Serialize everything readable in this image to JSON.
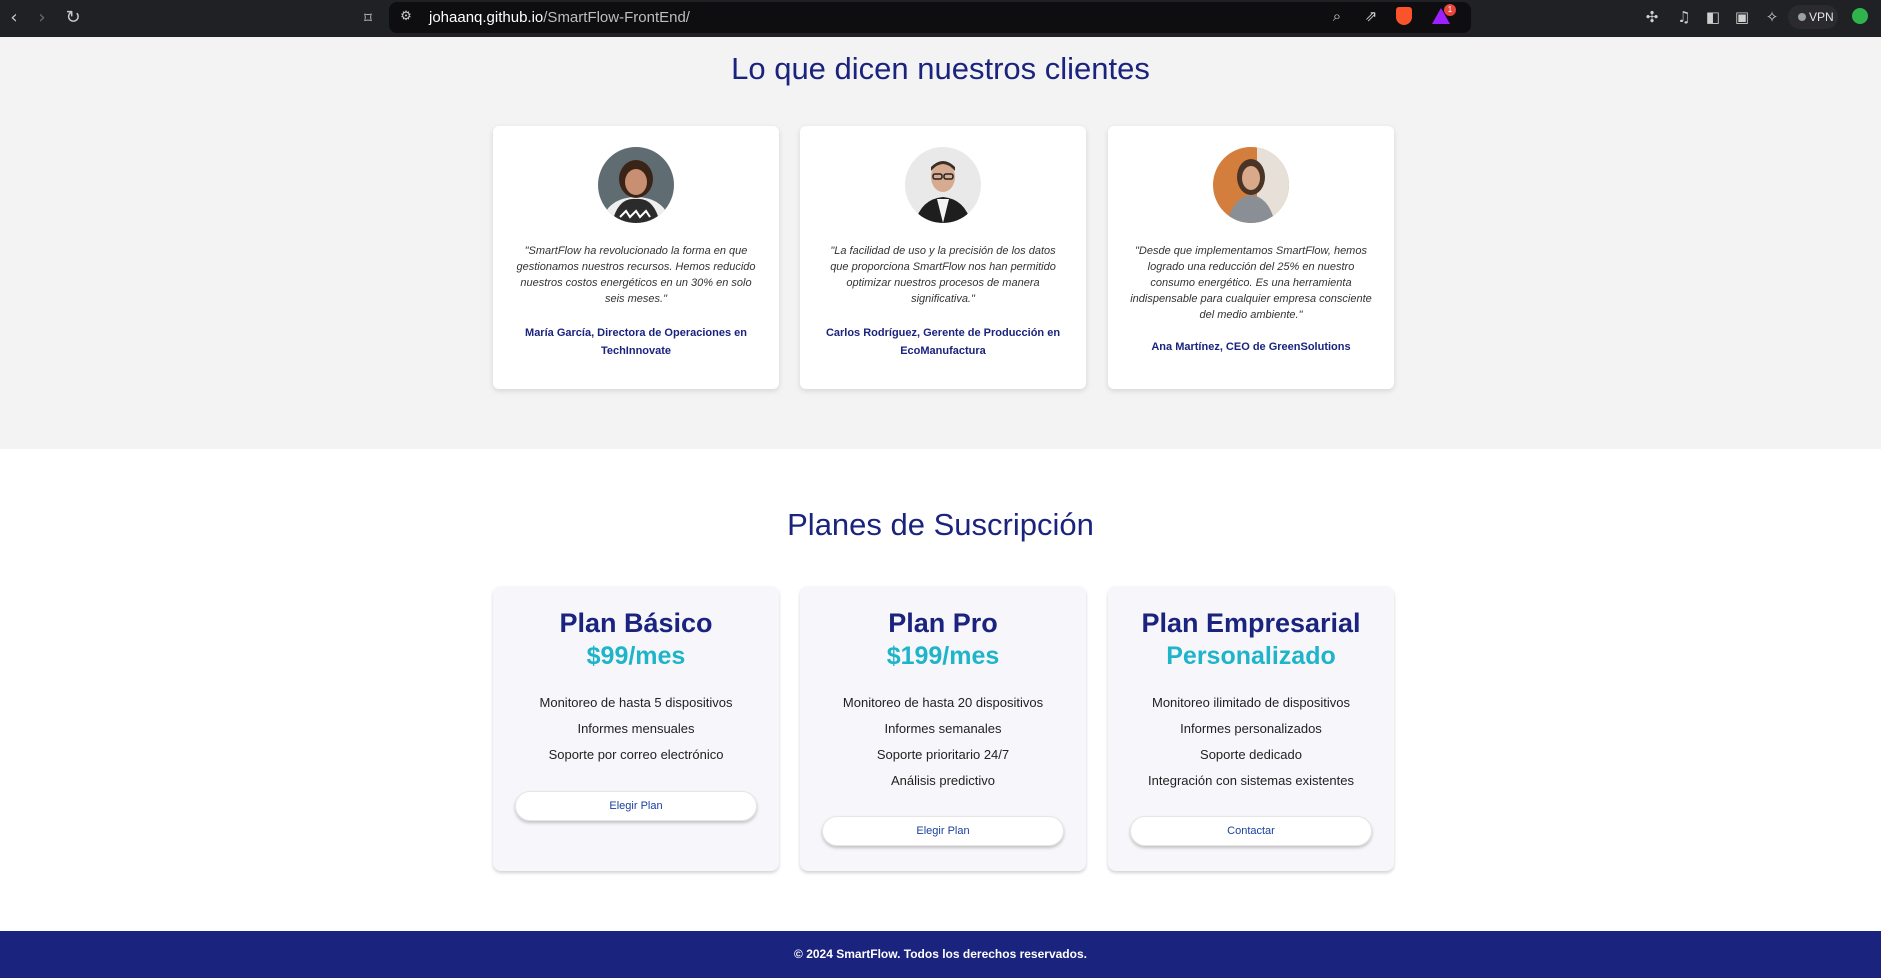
{
  "browser": {
    "url_domain": "johaanq.github.io",
    "url_path": "/SmartFlow-FrontEnd/",
    "notification_count": "1",
    "vpn_label": "VPN",
    "icons": [
      "back-icon",
      "forward-icon",
      "reload-icon",
      "bookmark-icon",
      "site-settings-icon",
      "zoom-icon",
      "share-icon",
      "brave-shields-icon",
      "brave-rewards-icon",
      "extensions-icon",
      "media-icon",
      "sidebar-icon",
      "wallet-icon",
      "leo-ai-icon",
      "profile-icon"
    ]
  },
  "testimonials": {
    "title": "Lo que dicen nuestros clientes",
    "items": [
      {
        "quote": "\"SmartFlow ha revolucionado la forma en que gestionamos nuestros recursos. Hemos reducido nuestros costos energéticos en un 30% en solo seis meses.\"",
        "author": "María García, Directora de Operaciones en TechInnovate"
      },
      {
        "quote": "\"La facilidad de uso y la precisión de los datos que proporciona SmartFlow nos han permitido optimizar nuestros procesos de manera significativa.\"",
        "author": "Carlos Rodríguez, Gerente de Producción en EcoManufactura"
      },
      {
        "quote": "\"Desde que implementamos SmartFlow, hemos logrado una reducción del 25% en nuestro consumo energético. Es una herramienta indispensable para cualquier empresa consciente del medio ambiente.\"",
        "author": "Ana Martínez, CEO de GreenSolutions"
      }
    ]
  },
  "plans": {
    "title": "Planes de Suscripción",
    "items": [
      {
        "name": "Plan Básico",
        "price": "$99/mes",
        "features": [
          "Monitoreo de hasta 5 dispositivos",
          "Informes mensuales",
          "Soporte por correo electrónico"
        ],
        "button": "Elegir Plan"
      },
      {
        "name": "Plan Pro",
        "price": "$199/mes",
        "features": [
          "Monitoreo de hasta 20 dispositivos",
          "Informes semanales",
          "Soporte prioritario 24/7",
          "Análisis predictivo"
        ],
        "button": "Elegir Plan"
      },
      {
        "name": "Plan Empresarial",
        "price": "Personalizado",
        "features": [
          "Monitoreo ilimitado de dispositivos",
          "Informes personalizados",
          "Soporte dedicado",
          "Integración con sistemas existentes"
        ],
        "button": "Contactar"
      }
    ]
  },
  "footer": {
    "text": "© 2024 SmartFlow. Todos los derechos reservados."
  },
  "colors": {
    "primary": "#1a237e",
    "accent": "#1eb4c9",
    "section_bg": "#f3f3f3",
    "button_text": "#1a3f9e"
  }
}
